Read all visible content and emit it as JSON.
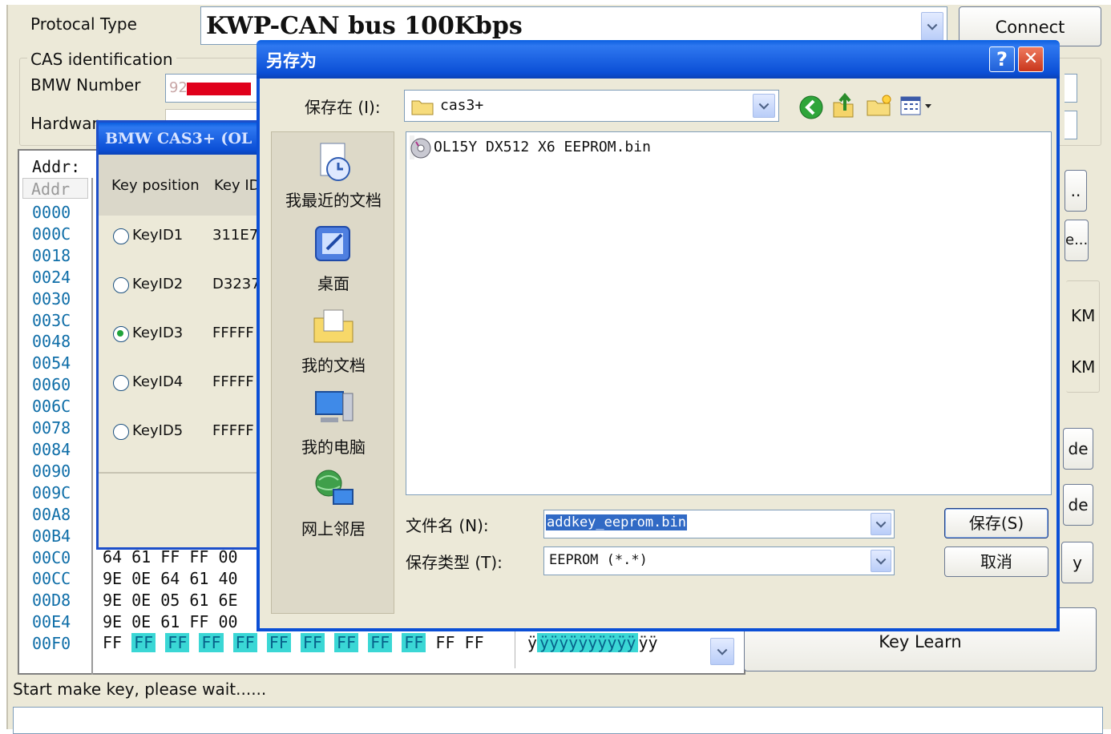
{
  "main": {
    "protocol_label": "Protocal Type",
    "protocol_value": "KWP-CAN bus 100Kbps",
    "connect_label": "Connect",
    "cas_group": "CAS identification",
    "bmw_number_label": "BMW Number",
    "bmw_number_value": "92",
    "hardware_label": "Hardwar",
    "addr_header": "Addr:",
    "addr_subheader": "Addr",
    "addresses": [
      "0000",
      "000C",
      "0018",
      "0024",
      "0030",
      "003C",
      "0048",
      "0054",
      "0060",
      "006C",
      "0078",
      "0084",
      "0090",
      "009C",
      "00A8",
      "00B4",
      "00C0",
      "00CC",
      "00D8",
      "00E4",
      "00F0"
    ],
    "hex_rows": [
      {
        "addr": "00C0",
        "bytes": "64 61 FF FF 00"
      },
      {
        "addr": "00CC",
        "bytes": "9E 0E 64 61 40"
      },
      {
        "addr": "00D8",
        "bytes": "9E 0E 05 61 6E"
      },
      {
        "addr": "00E4",
        "bytes": "9E 0E 61 FF 00"
      }
    ],
    "last_row": {
      "first": "FF",
      "selected": [
        "FF",
        "FF",
        "FF",
        "FF",
        "FF",
        "FF",
        "FF",
        "FF",
        "FF"
      ],
      "tail": [
        "FF",
        "FF"
      ]
    },
    "ascii_last": {
      "pre": "ÿ",
      "selected": "ÿÿÿÿÿÿÿÿÿÿ",
      "post": "ÿÿ"
    },
    "right_buttons": {
      "b1": "..",
      "b2": "e...",
      "km1": "KM",
      "km2": "KM",
      "b3": "de",
      "b4": "de",
      "b5": "y"
    },
    "key_learn_label": "Key Learn",
    "status_text": "Start make key, please wait......"
  },
  "key_dialog": {
    "title": "BMW CAS3+ (OL",
    "col_position": "Key position",
    "col_id": "Key ID",
    "keys": [
      {
        "name": "KeyID1",
        "id": "311E7"
      },
      {
        "name": "KeyID2",
        "id": "D3237"
      },
      {
        "name": "KeyID3",
        "id": "FFFFF"
      },
      {
        "name": "KeyID4",
        "id": "FFFFF"
      },
      {
        "name": "KeyID5",
        "id": "FFFFF"
      }
    ],
    "selected_key": "KeyID3"
  },
  "save_dialog": {
    "title": "另存为",
    "help_glyph": "?",
    "close_glyph": "✕",
    "save_in_label": "保存在 (I):",
    "save_in_value": "cas3+",
    "places": [
      "我最近的文档",
      "桌面",
      "我的文档",
      "我的电脑",
      "网上邻居"
    ],
    "files": [
      "OL15Y DX512 X6 EEPROM.bin"
    ],
    "filename_label": "文件名 (N):",
    "filename_value": "addkey_eeprom.bin",
    "filetype_label": "保存类型 (T):",
    "filetype_value": "EEPROM (*.*)",
    "save_button": "保存(S)",
    "cancel_button": "取消"
  },
  "colors": {
    "xp_title_blue": "#0b4fd6",
    "selection_cyan": "#3ad7d5",
    "close_red": "#e0482f"
  }
}
